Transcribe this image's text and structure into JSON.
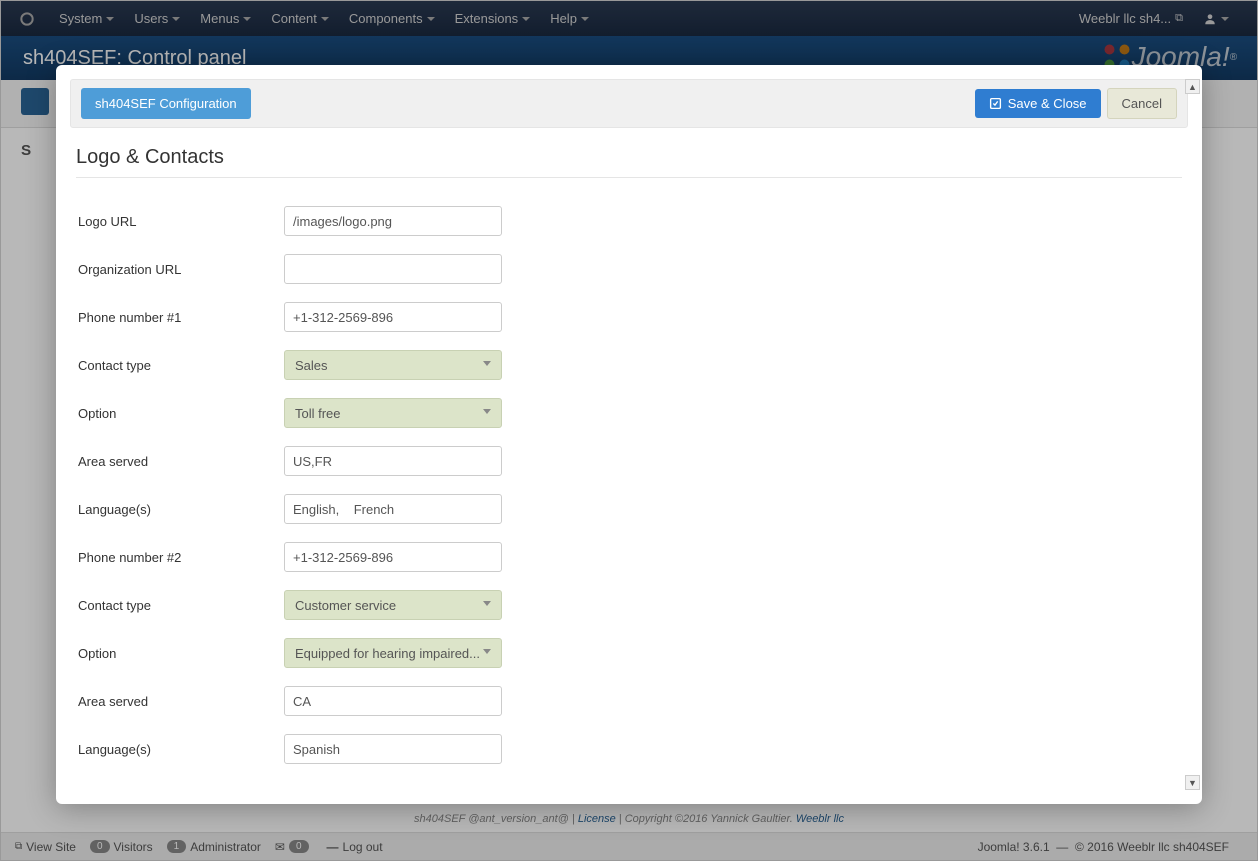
{
  "topnav": {
    "items": [
      "System",
      "Users",
      "Menus",
      "Content",
      "Components",
      "Extensions",
      "Help"
    ],
    "site_link": "Weeblr llc sh4..."
  },
  "header": {
    "title": "sh404SEF: Control panel",
    "brand": "Joomla!"
  },
  "modal": {
    "title_btn": "sh404SEF Configuration",
    "save_label": "Save & Close",
    "cancel_label": "Cancel",
    "section_title": "Logo & Contacts",
    "fields": [
      {
        "label": "Logo URL",
        "type": "text",
        "value": "/images/logo.png"
      },
      {
        "label": "Organization URL",
        "type": "text",
        "value": ""
      },
      {
        "label": "Phone number #1",
        "type": "text",
        "value": "+1-312-2569-896"
      },
      {
        "label": "Contact type",
        "type": "select",
        "value": "Sales"
      },
      {
        "label": "Option",
        "type": "select",
        "value": "Toll free"
      },
      {
        "label": "Area served",
        "type": "text",
        "value": "US,FR"
      },
      {
        "label": "Language(s)",
        "type": "text",
        "value": "English,    French"
      },
      {
        "label": "Phone number #2",
        "type": "text",
        "value": "+1-312-2569-896"
      },
      {
        "label": "Contact type",
        "type": "select",
        "value": "Customer service"
      },
      {
        "label": "Option",
        "type": "select",
        "value": "Equipped for hearing impaired..."
      },
      {
        "label": "Area served",
        "type": "text",
        "value": "CA"
      },
      {
        "label": "Language(s)",
        "type": "text",
        "value": "Spanish"
      }
    ]
  },
  "footer1": {
    "part1": "sh404SEF @ant_version_ant@ | ",
    "license": "License",
    "part2": " | Copyright ©2016 Yannick Gaultier. ",
    "company": "Weeblr llc"
  },
  "footer2": {
    "view_site": "View Site",
    "visitors_count": "0",
    "visitors_label": "Visitors",
    "admins_count": "1",
    "admins_label": "Administrator",
    "messages_count": "0",
    "logout": "Log out",
    "version": "Joomla! 3.6.1",
    "sep": "—",
    "copyright": "© 2016 Weeblr llc sh404SEF"
  }
}
